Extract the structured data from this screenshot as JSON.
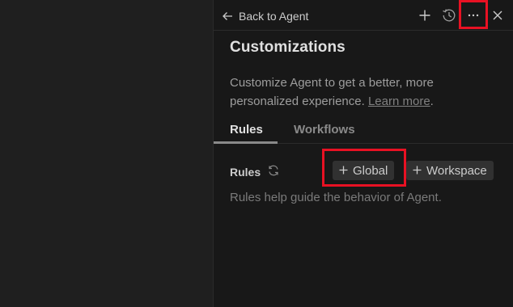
{
  "header": {
    "back_label": "Back to Agent",
    "icons": [
      "arrow-left-icon",
      "plus-icon",
      "history-icon",
      "ellipsis-icon",
      "close-icon"
    ]
  },
  "panel": {
    "title": "Customizations",
    "description": "Customize Agent to get a better, more personalized experience.",
    "learn_more": "Learn more",
    "period": "."
  },
  "tabs": [
    {
      "label": "Rules",
      "active": true
    },
    {
      "label": "Workflows",
      "active": false
    }
  ],
  "rules": {
    "label": "Rules",
    "global_button": "Global",
    "workspace_button": "Workspace",
    "help_text": "Rules help guide the behavior of Agent."
  },
  "colors": {
    "highlight": "#e81123",
    "panel_bg": "#181818",
    "editor_bg": "#1f1f1f",
    "chip_bg": "#313131"
  }
}
